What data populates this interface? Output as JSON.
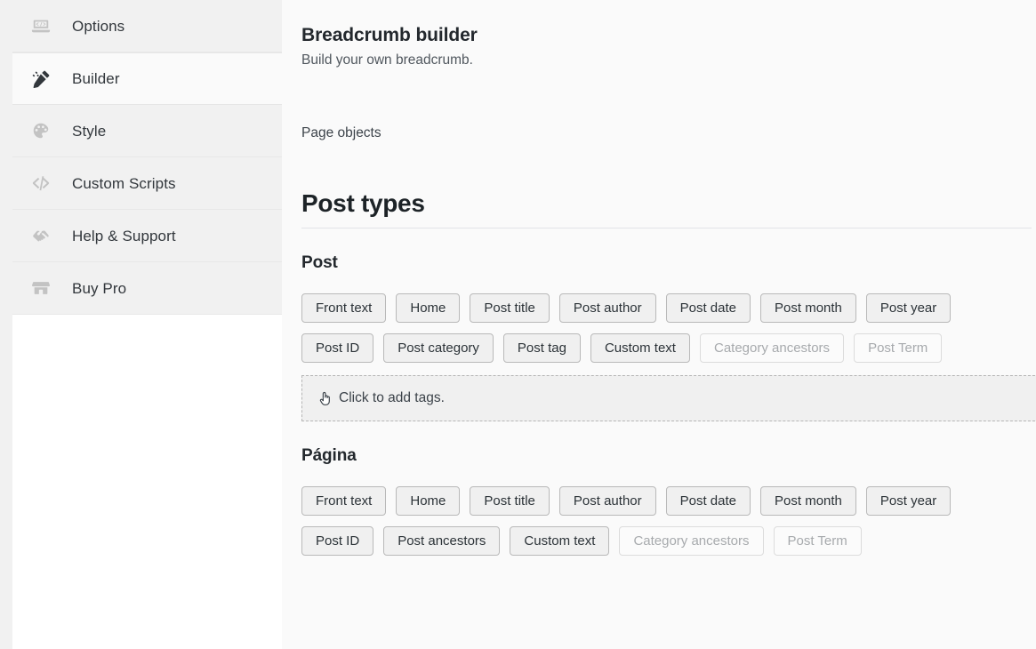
{
  "sidebar": {
    "items": [
      {
        "label": "Options",
        "icon": "laptop-code-icon",
        "active": false
      },
      {
        "label": "Builder",
        "icon": "magic-wand-icon",
        "active": true
      },
      {
        "label": "Style",
        "icon": "palette-icon",
        "active": false
      },
      {
        "label": "Custom Scripts",
        "icon": "code-brackets-icon",
        "active": false
      },
      {
        "label": "Help & Support",
        "icon": "handshake-icon",
        "active": false
      },
      {
        "label": "Buy Pro",
        "icon": "store-icon",
        "active": false
      }
    ]
  },
  "header": {
    "title": "Breadcrumb builder",
    "subtitle": "Build your own breadcrumb.",
    "page_objects_label": "Page objects"
  },
  "sections": [
    {
      "heading": "Post types",
      "groups": [
        {
          "name": "Post",
          "rows": [
            [
              {
                "label": "Front text",
                "disabled": false
              },
              {
                "label": "Home",
                "disabled": false
              },
              {
                "label": "Post title",
                "disabled": false
              },
              {
                "label": "Post author",
                "disabled": false
              },
              {
                "label": "Post date",
                "disabled": false
              },
              {
                "label": "Post month",
                "disabled": false
              },
              {
                "label": "Post year",
                "disabled": false
              }
            ],
            [
              {
                "label": "Post ID",
                "disabled": false
              },
              {
                "label": "Post category",
                "disabled": false
              },
              {
                "label": "Post tag",
                "disabled": false
              },
              {
                "label": "Custom text",
                "disabled": false
              },
              {
                "label": "Category ancestors",
                "disabled": true
              },
              {
                "label": "Post Term",
                "disabled": true
              }
            ]
          ],
          "dropzone": {
            "text": "Click to add tags.",
            "icon": "pointing-hand-icon"
          }
        },
        {
          "name": "Página",
          "rows": [
            [
              {
                "label": "Front text",
                "disabled": false
              },
              {
                "label": "Home",
                "disabled": false
              },
              {
                "label": "Post title",
                "disabled": false
              },
              {
                "label": "Post author",
                "disabled": false
              },
              {
                "label": "Post date",
                "disabled": false
              },
              {
                "label": "Post month",
                "disabled": false
              },
              {
                "label": "Post year",
                "disabled": false
              }
            ],
            [
              {
                "label": "Post ID",
                "disabled": false
              },
              {
                "label": "Post ancestors",
                "disabled": false
              },
              {
                "label": "Custom text",
                "disabled": false
              },
              {
                "label": "Category ancestors",
                "disabled": true
              },
              {
                "label": "Post Term",
                "disabled": true
              }
            ]
          ],
          "dropzone": null
        }
      ]
    }
  ],
  "colors": {
    "sidebar_bg": "#f1f1f1",
    "sidebar_active_bg": "#fafafa",
    "content_bg": "#fafafa",
    "text_dark": "#23282d",
    "text_muted": "#50575e",
    "button_bg": "#f0f0f0",
    "button_border": "#b9b9b9",
    "disabled_text": "#a7aaad"
  }
}
